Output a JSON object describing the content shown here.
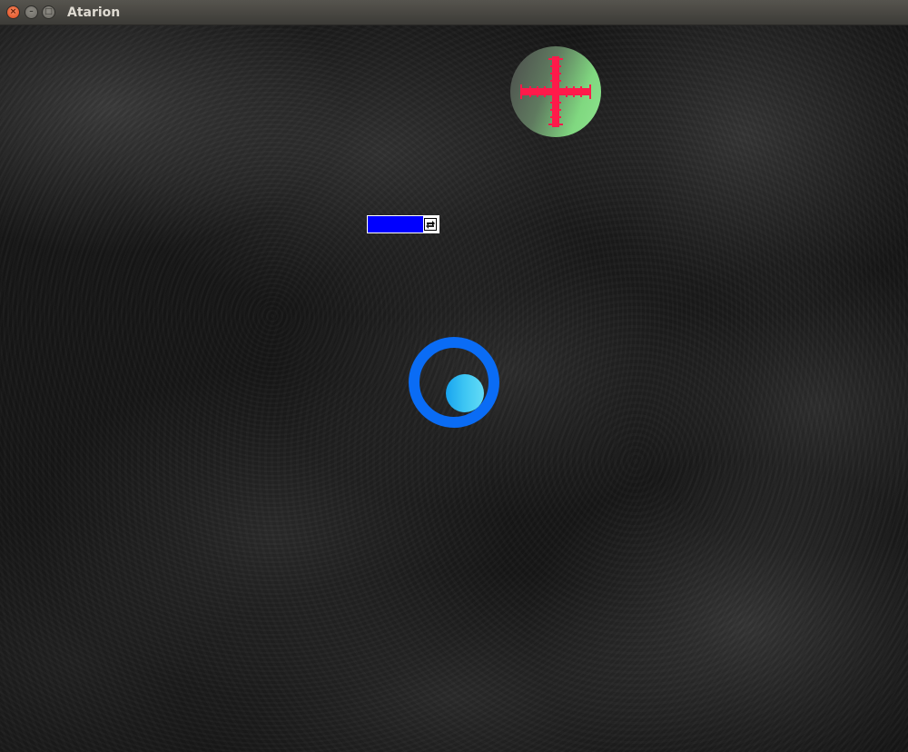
{
  "window": {
    "title": "Atarion"
  },
  "colors": {
    "crosshair": "#ff1a4a",
    "target_fill_light": "#8ee48e",
    "target_fill_dark": "#4c4c4c",
    "bar_fill": "#0000ff",
    "bar_bg": "#ffffff",
    "player_ring": "#0a6cf5",
    "player_core": "#3ec6f3"
  },
  "game": {
    "target": {
      "icon": "crosshair-icon"
    },
    "power_bar": {
      "level_percent": 78,
      "icon": "swap-icon"
    },
    "player": {
      "icon": "ring-orb-icon"
    }
  }
}
